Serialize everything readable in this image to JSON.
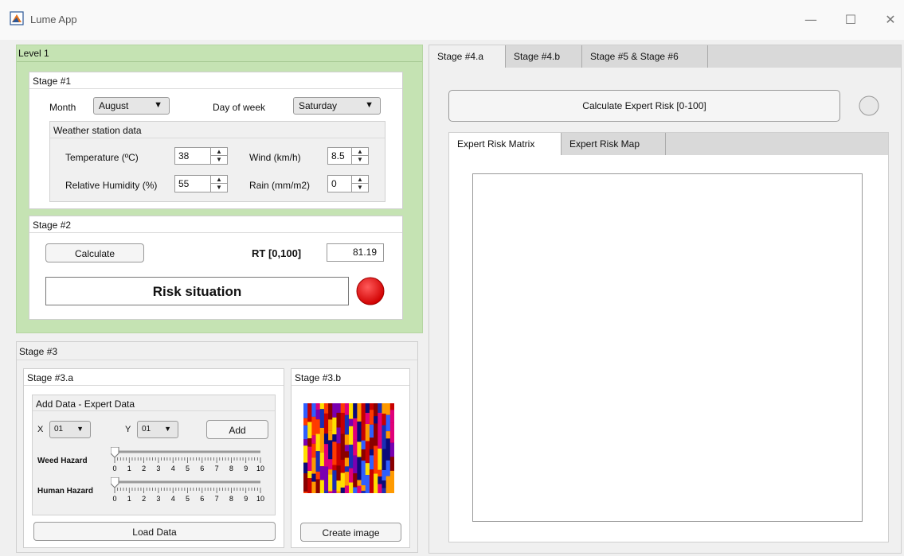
{
  "window": {
    "title": "Lume App",
    "minimize": "—",
    "maximize": "☐",
    "close": "✕"
  },
  "level1": {
    "title": "Level 1"
  },
  "stage1": {
    "title": "Stage #1",
    "month_label": "Month",
    "month_value": "August",
    "dow_label": "Day of week",
    "dow_value": "Saturday",
    "weather": {
      "title": "Weather station data",
      "temp_label": "Temperature (ºC)",
      "temp_value": "38",
      "wind_label": "Wind (km/h)",
      "wind_value": "8.5",
      "humidity_label": "Relative Humidity (%)",
      "humidity_value": "55",
      "rain_label": "Rain (mm/m2)",
      "rain_value": "0"
    }
  },
  "stage2": {
    "title": "Stage #2",
    "calculate_label": "Calculate",
    "rt_label": "RT [0,100]",
    "rt_value": "81.19",
    "risk_text": "Risk situation",
    "risk_color": "#e00000"
  },
  "stage3": {
    "title": "Stage #3",
    "a": {
      "title": "Stage #3.a",
      "add_data_title": "Add Data - Expert Data",
      "x_label": "X",
      "x_value": "01",
      "y_label": "Y",
      "y_value": "01",
      "add_label": "Add",
      "weed_label": "Weed Hazard",
      "human_label": "Human Hazard",
      "weed_value": 0,
      "human_value": 0,
      "slider_ticks": [
        "0",
        "1",
        "2",
        "3",
        "4",
        "5",
        "6",
        "7",
        "8",
        "9",
        "10"
      ],
      "load_label": "Load Data"
    },
    "b": {
      "title": "Stage #3.b",
      "create_label": "Create image"
    }
  },
  "right": {
    "tabs": [
      "Stage #4.a",
      "Stage #4.b",
      "Stage #5 & Stage #6"
    ],
    "calc_expert_label": "Calculate Expert Risk [0-100]",
    "subtabs": [
      "Expert Risk Matrix",
      "Expert Risk Map"
    ]
  },
  "colors": {
    "level1_bg": "#c5e3b3",
    "lamp_off": "#e8e8e8"
  }
}
